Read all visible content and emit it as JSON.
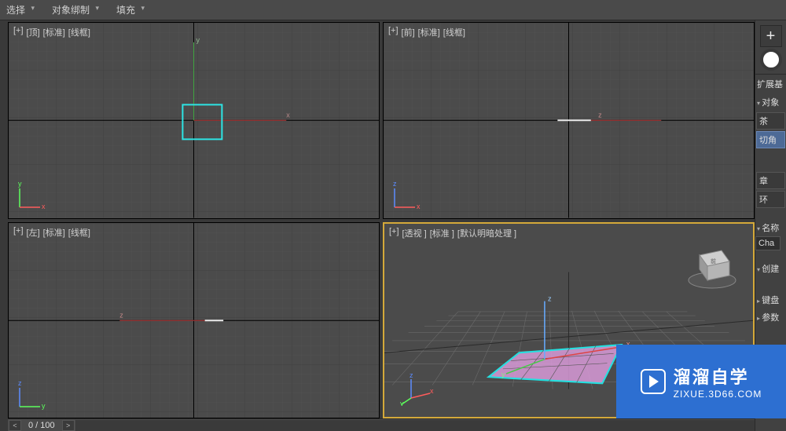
{
  "toolbar": {
    "select": "选择",
    "object_binding": "对象绑制",
    "fill": "填充"
  },
  "viewports": {
    "top": {
      "plus": "[+]",
      "name": "[顶]",
      "mode": "[标准]",
      "shade": "[线框]",
      "axes": {
        "a": "y",
        "b": "x"
      }
    },
    "front": {
      "plus": "[+]",
      "name": "[前]",
      "mode": "[标准]",
      "shade": "[线框]",
      "axes": {
        "a": "z",
        "b": "x"
      }
    },
    "left": {
      "plus": "[+]",
      "name": "[左]",
      "mode": "[标准]",
      "shade": "[线框]",
      "axes": {
        "a": "z",
        "b": "y"
      }
    },
    "persp": {
      "plus": "[+]",
      "name": "[透视 ]",
      "mode": "[标准 ]",
      "shade": "[默认明暗处理 ]",
      "axes": {
        "a": "z",
        "b": "x",
        "c": "y"
      }
    }
  },
  "panel": {
    "ext_primitives": "扩展基",
    "object_type": "对象",
    "btn1": "茶",
    "btn2": "切角",
    "btn3": "章",
    "btn4": "环",
    "name_hdr": "名称",
    "name_val": "Cha",
    "create_hdr": "创建",
    "keyboard_hdr": "键盘",
    "params_hdr": "参数"
  },
  "timeline": {
    "frame": "0 / 100"
  },
  "watermark": {
    "brand": "溜溜自学",
    "url": "ZIXUE.3D66.COM"
  }
}
